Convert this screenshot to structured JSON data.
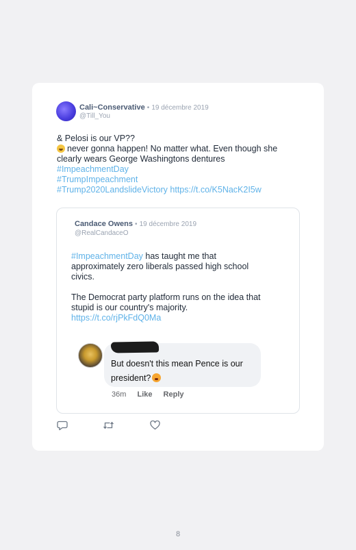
{
  "tweet": {
    "author_name": "Cali~Conservative",
    "separator": "•",
    "date": "19 décembre 2019",
    "handle": "@Till_You",
    "lines": [
      "& Pelosi is our VP??",
      "never gonna happen! No matter what. Even though she",
      "clearly wears George Washingtons dentures"
    ],
    "hashtags": [
      "#ImpeachmentDay",
      "#TrumpImpeachment",
      "#Trump2020LandslideVictory"
    ],
    "link": "https://t.co/K5NacK2I5w"
  },
  "quoted_tweet": {
    "author_name": "Candace Owens",
    "separator": "•",
    "date": "19 décembre 2019",
    "handle": "@RealCandaceO",
    "hashtag": "#ImpeachmentDay",
    "line1_rest": " has taught me that",
    "line2": "approximately zero liberals passed high school",
    "line3": "civics.",
    "line4": "The Democrat party platform runs on the idea that",
    "line5": "stupid is our country's majority.",
    "link": "https://t.co/rjPkFdQ0Ma"
  },
  "fb_comment": {
    "line1": "But doesn't this mean Pence is our",
    "line2": "president?",
    "time": "36m",
    "like_label": "Like",
    "reply_label": "Reply"
  },
  "actions": {
    "icons": [
      "reply-icon",
      "retweet-icon",
      "like-icon"
    ]
  },
  "page_number": "8",
  "colors": {
    "background": "#f1f1f3",
    "card": "#ffffff",
    "link": "#5fb2e8",
    "name": "#4a5a73",
    "muted": "#9aa3b1"
  }
}
